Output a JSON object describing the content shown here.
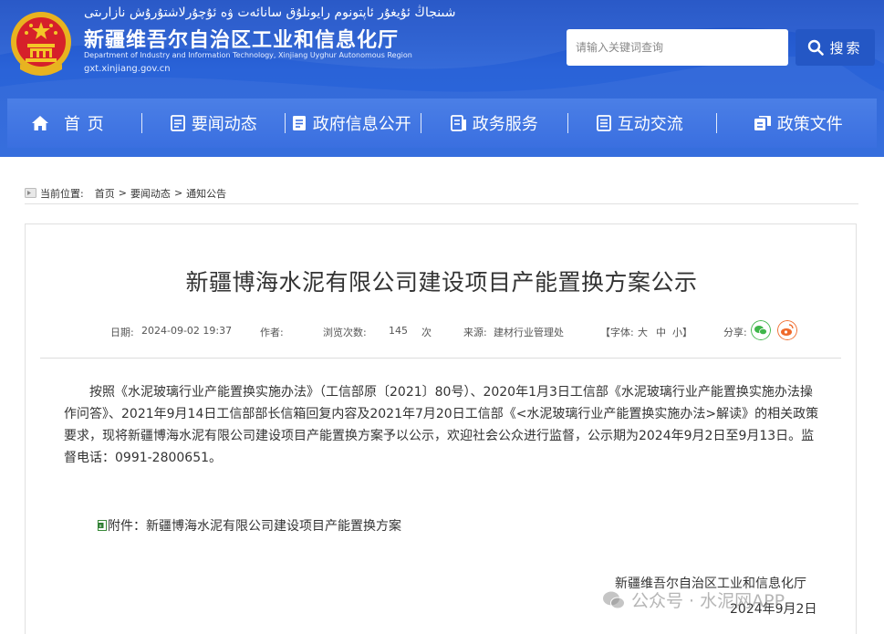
{
  "header": {
    "uyghur_title": "شىنجاڭ ئۇيغۇر ئاپتونوم رايونلۇق سانائەت ۋە ئۇچۇرلاشتۇرۇش نازارىتى",
    "site_title": "新疆维吾尔自治区工业和信息化厅",
    "site_en": "Department of Industry and Information Technology, Xinjiang Uyghur Autonomous Region",
    "site_domain": "gxt.xinjiang.gov.cn",
    "search_placeholder": "请输入关键词查询",
    "search_label": "搜索"
  },
  "nav": {
    "items": [
      {
        "label": "首 页",
        "icon": "home-icon"
      },
      {
        "label": "要闻动态",
        "icon": "news-icon"
      },
      {
        "label": "政府信息公开",
        "icon": "info-icon"
      },
      {
        "label": "政务服务",
        "icon": "service-icon"
      },
      {
        "label": "互动交流",
        "icon": "interact-icon"
      },
      {
        "label": "政策文件",
        "icon": "policy-icon"
      }
    ]
  },
  "breadcrumb": {
    "prefix": "当前位置:",
    "items": [
      "首页",
      "要闻动态",
      "通知公告"
    ],
    "separator": ">"
  },
  "article": {
    "title": "新疆博海水泥有限公司建设项目产能置换方案公示",
    "meta": {
      "date_label": "日期:",
      "date": "2024-09-02 19:37",
      "author_label": "作者:",
      "views_label": "浏览次数:",
      "views": "145",
      "views_unit": "次",
      "source_label": "来源:",
      "source": "建材行业管理处",
      "font_open": "【字体:",
      "font_large": "大",
      "font_medium": "中",
      "font_small": "小",
      "font_close": "】",
      "share_label": "分享:"
    },
    "body": "按照《水泥玻璃行业产能置换实施办法》（工信部原〔2021〕80号）、2020年1月3日工信部《水泥玻璃行业产能置换实施办法操作问答》、2021年9月14日工信部部长信箱回复内容及2021年7月20日工信部《<水泥玻璃行业产能置换实施办法>解读》的相关政策要求，现将新疆博海水泥有限公司建设项目产能置换方案予以公示，欢迎社会公众进行监督，公示期为2024年9月2日至9月13日。监督电话：0991-2800651。",
    "attachment_label": "附件：新疆博海水泥有限公司建设项目产能置换方案",
    "signature_org": "新疆维吾尔自治区工业和信息化厅",
    "signature_date": "2024年9月2日"
  },
  "watermark": "公众号 · 水泥网APP",
  "colors": {
    "header_blue": "#2a63d8",
    "nav_blue": "#3a6fe0",
    "search_button": "#2457c5",
    "wechat_green": "#3fb64a",
    "weibo_orange": "#f06a2b"
  }
}
